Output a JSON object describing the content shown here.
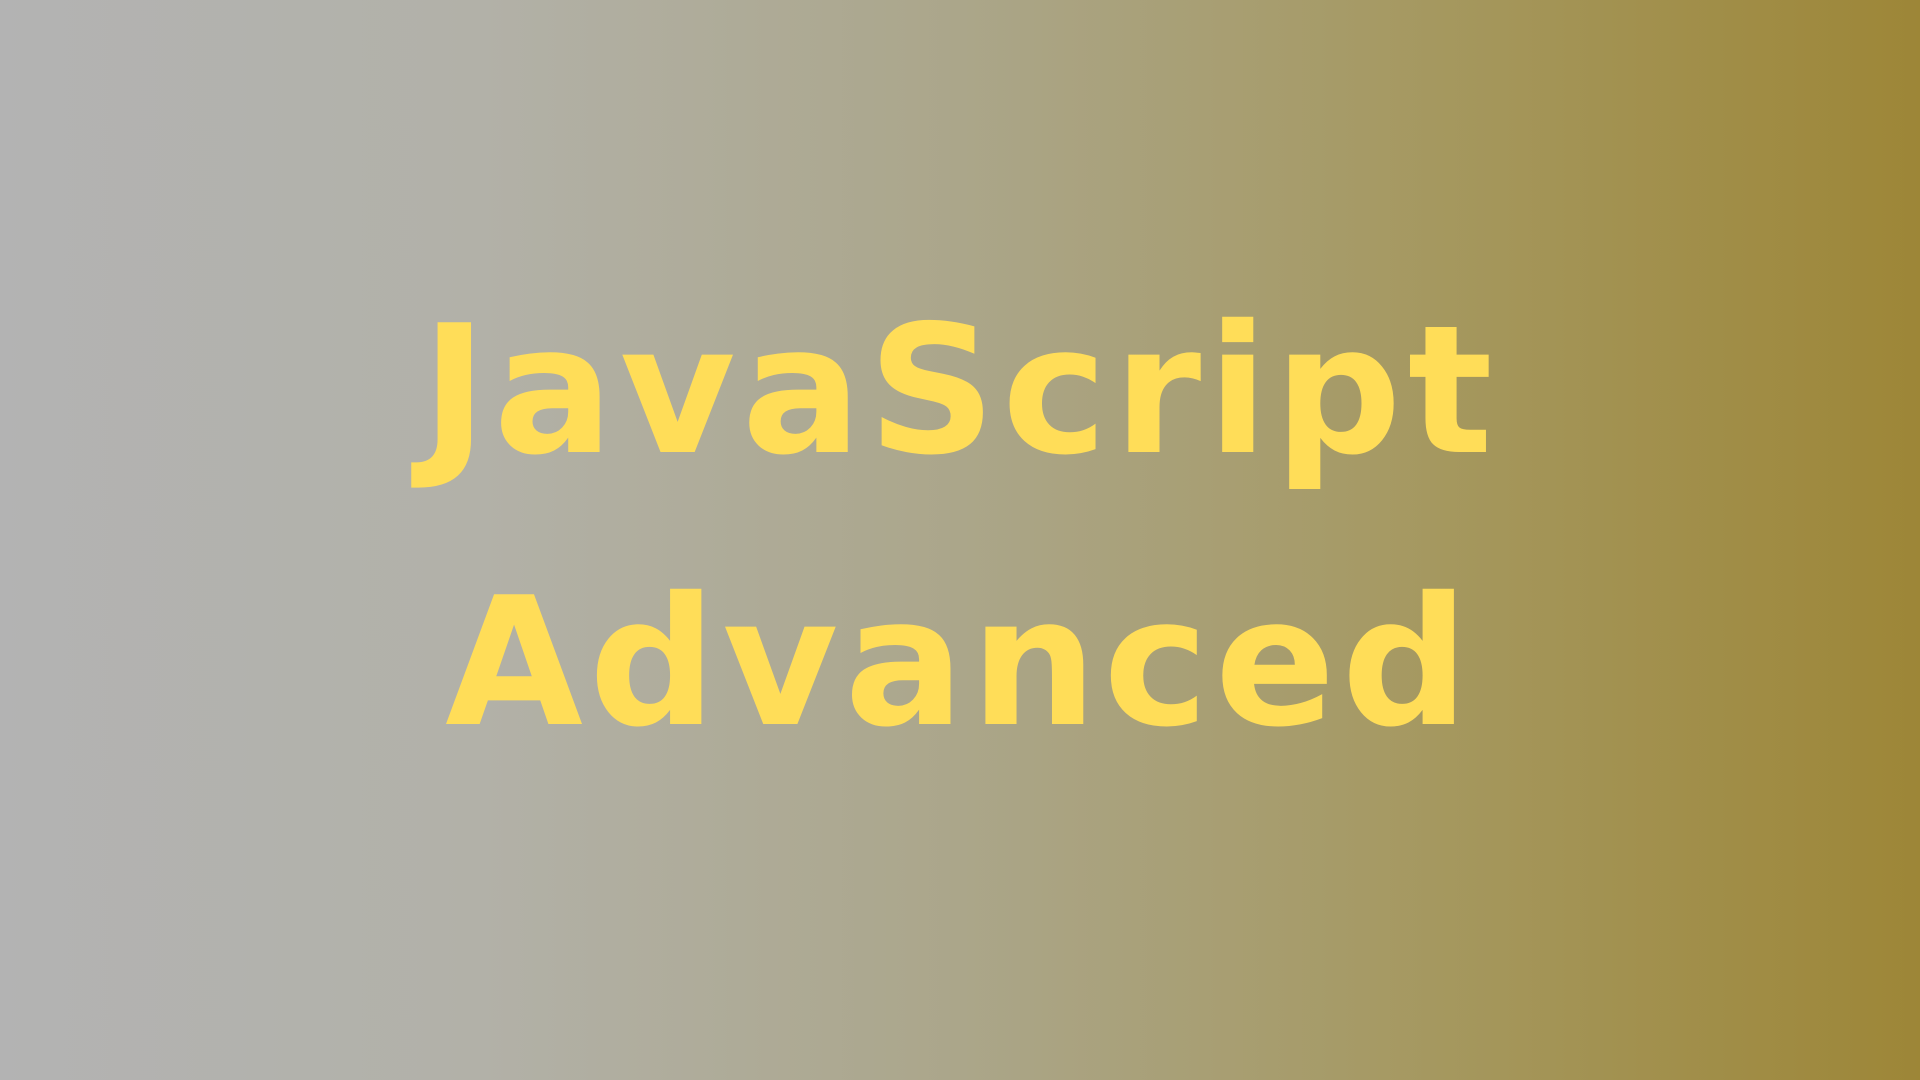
{
  "title": {
    "line1": "JavaScript",
    "line2": "Advanced"
  },
  "colors": {
    "text": "#ffdd58",
    "gradient_left": "#b3b3b3",
    "gradient_right": "#9d8637"
  }
}
